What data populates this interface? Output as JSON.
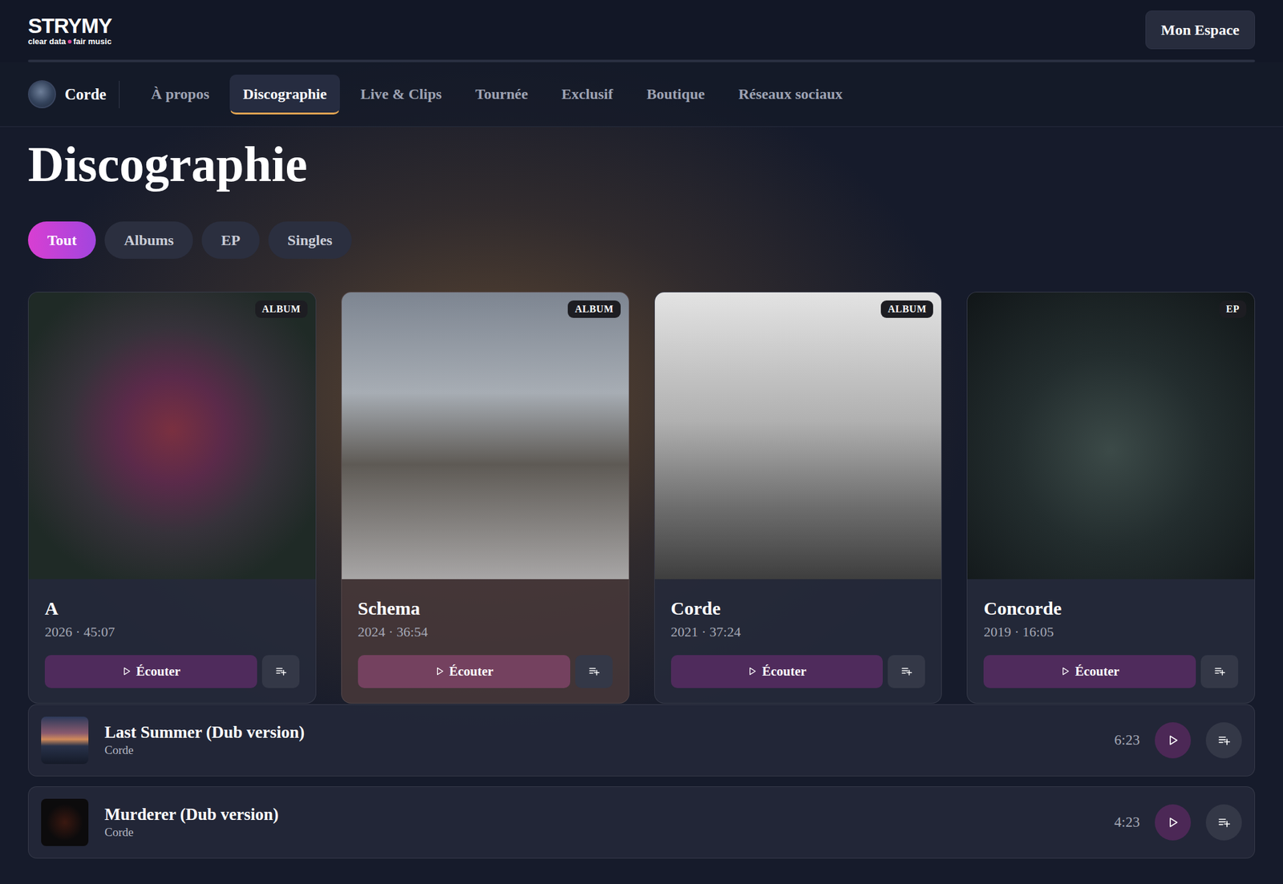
{
  "header": {
    "logo": {
      "wordmark": "STRYMY",
      "tagline_start": "clear data",
      "tagline_end": "fair music"
    },
    "account_button": "Mon Espace"
  },
  "artist_nav": {
    "artist_name": "Corde",
    "tabs": [
      {
        "label": "À propos",
        "selected": false
      },
      {
        "label": "Discographie",
        "selected": true
      },
      {
        "label": "Live & Clips",
        "selected": false
      },
      {
        "label": "Tournée",
        "selected": false
      },
      {
        "label": "Exclusif",
        "selected": false
      },
      {
        "label": "Boutique",
        "selected": false
      },
      {
        "label": "Réseaux sociaux",
        "selected": false
      }
    ]
  },
  "page_title": "Discographie",
  "filters": [
    {
      "label": "Tout",
      "selected": true
    },
    {
      "label": "Albums",
      "selected": false
    },
    {
      "label": "EP",
      "selected": false
    },
    {
      "label": "Singles",
      "selected": false
    }
  ],
  "releases": [
    {
      "title": "A",
      "meta": "2026 · 45:07",
      "badge": "ALBUM",
      "play_label": "Écouter",
      "hovered": false
    },
    {
      "title": "Schema",
      "meta": "2024 · 36:54",
      "badge": "ALBUM",
      "play_label": "Écouter",
      "hovered": true
    },
    {
      "title": "Corde",
      "meta": "2021 · 37:24",
      "badge": "ALBUM",
      "play_label": "Écouter",
      "hovered": false
    },
    {
      "title": "Concorde",
      "meta": "2019 · 16:05",
      "badge": "EP",
      "play_label": "Écouter",
      "hovered": false
    }
  ],
  "tracks": [
    {
      "title": "Last Summer (Dub version)",
      "artist": "Corde",
      "duration": "6:23"
    },
    {
      "title": "Murderer (Dub version)",
      "artist": "Corde",
      "duration": "4:23"
    }
  ]
}
